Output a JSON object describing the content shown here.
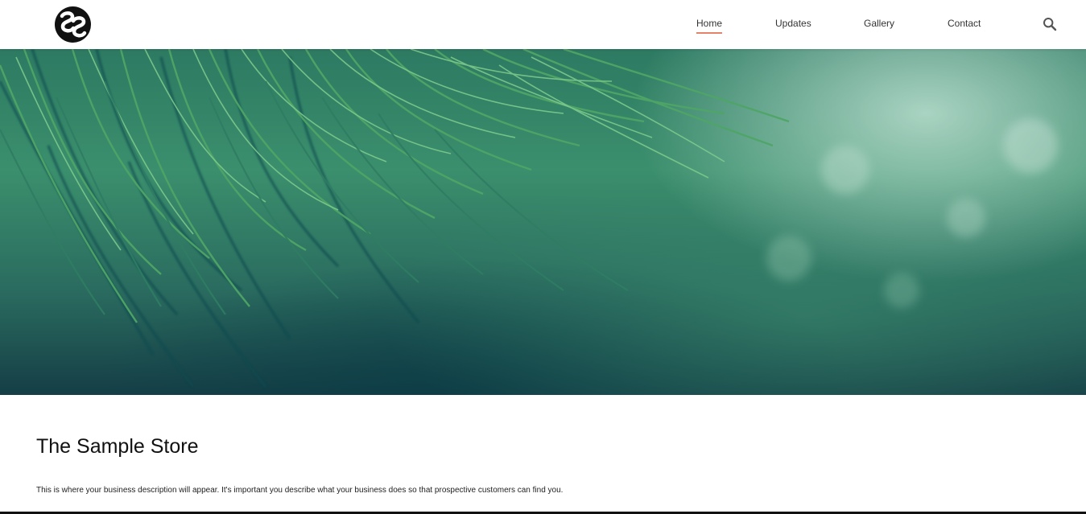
{
  "header": {
    "logo_text": "SS",
    "nav": [
      {
        "label": "Home",
        "active": true
      },
      {
        "label": "Updates",
        "active": false
      },
      {
        "label": "Gallery",
        "active": false
      },
      {
        "label": "Contact",
        "active": false
      }
    ],
    "search_icon": "search-icon",
    "active_underline_color": "#e5826a"
  },
  "hero": {
    "image_subject": "close-up of green grass blades"
  },
  "main": {
    "title": "The Sample Store",
    "description": "This is where your business description will appear. It's important you describe what your business does so that prospective customers can find you."
  }
}
